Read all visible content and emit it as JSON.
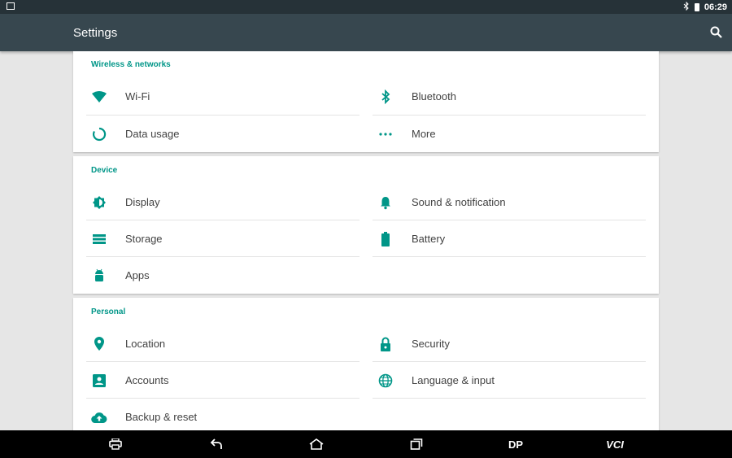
{
  "status": {
    "time": "06:29"
  },
  "app": {
    "title": "Settings"
  },
  "sections": {
    "wireless": {
      "header": "Wireless & networks",
      "items": [
        {
          "label": "Wi-Fi",
          "icon": "wifi-icon"
        },
        {
          "label": "Bluetooth",
          "icon": "bluetooth-icon"
        },
        {
          "label": "Data usage",
          "icon": "data-usage-icon"
        },
        {
          "label": "More",
          "icon": "more-icon"
        }
      ]
    },
    "device": {
      "header": "Device",
      "items": [
        {
          "label": "Display",
          "icon": "display-icon"
        },
        {
          "label": "Sound & notification",
          "icon": "bell-icon"
        },
        {
          "label": "Storage",
          "icon": "storage-icon"
        },
        {
          "label": "Battery",
          "icon": "battery-icon"
        },
        {
          "label": "Apps",
          "icon": "android-icon"
        }
      ]
    },
    "personal": {
      "header": "Personal",
      "items": [
        {
          "label": "Location",
          "icon": "location-icon"
        },
        {
          "label": "Security",
          "icon": "lock-icon"
        },
        {
          "label": "Accounts",
          "icon": "account-icon"
        },
        {
          "label": "Language & input",
          "icon": "globe-icon"
        },
        {
          "label": "Backup & reset",
          "icon": "cloud-upload-icon"
        }
      ]
    }
  },
  "navbar": {
    "dp_label": "DP",
    "vci_label": "VCI"
  },
  "colors": {
    "accent": "#009688",
    "appbar": "#37474f",
    "statusbar": "#263238"
  }
}
